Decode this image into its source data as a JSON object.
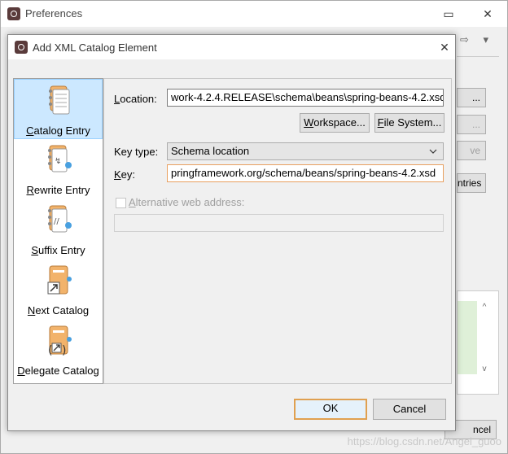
{
  "preferences": {
    "title": "Preferences",
    "side_buttons": [
      {
        "label": "..."
      },
      {
        "label": "..."
      },
      {
        "label": "ve"
      },
      {
        "label": "ntries"
      }
    ],
    "bottom_button": "ncel"
  },
  "dialog": {
    "title": "Add XML Catalog Element",
    "categories": [
      {
        "label": "Catalog Entry",
        "underline": "C",
        "rest": "atalog Entry",
        "selected": true
      },
      {
        "label": "Rewrite Entry",
        "underline": "R",
        "rest": "ewrite Entry",
        "selected": false
      },
      {
        "label": "Suffix Entry",
        "underline": "S",
        "rest": "uffix Entry",
        "selected": false
      },
      {
        "label": "Next Catalog",
        "underline": "N",
        "rest": "ext Catalog",
        "selected": false
      },
      {
        "label": "Delegate Catalog",
        "underline": "D",
        "rest": "elegate Catalog",
        "selected": false
      }
    ],
    "form": {
      "location_label_u": "L",
      "location_label_rest": "ocation:",
      "location_value": "work-4.2.4.RELEASE\\schema\\beans\\spring-beans-4.2.xsd",
      "workspace_u": "W",
      "workspace_rest": "orkspace...",
      "filesystem_u": "F",
      "filesystem_rest": "ile System...",
      "keytype_label": "Key type:",
      "keytype_value": "Schema location",
      "key_label_u": "K",
      "key_label_rest": "ey:",
      "key_value": "pringframework.org/schema/beans/spring-beans-4.2.xsd",
      "alt_u": "A",
      "alt_rest": "lternative web address:",
      "alt_value": ""
    },
    "ok": "OK",
    "cancel": "Cancel"
  },
  "watermark": "https://blog.csdn.net/Angel_guoo",
  "colors": {
    "selection": "#cce8ff",
    "default_button_border": "#e0a050",
    "icon_orange": "#f0b060"
  }
}
